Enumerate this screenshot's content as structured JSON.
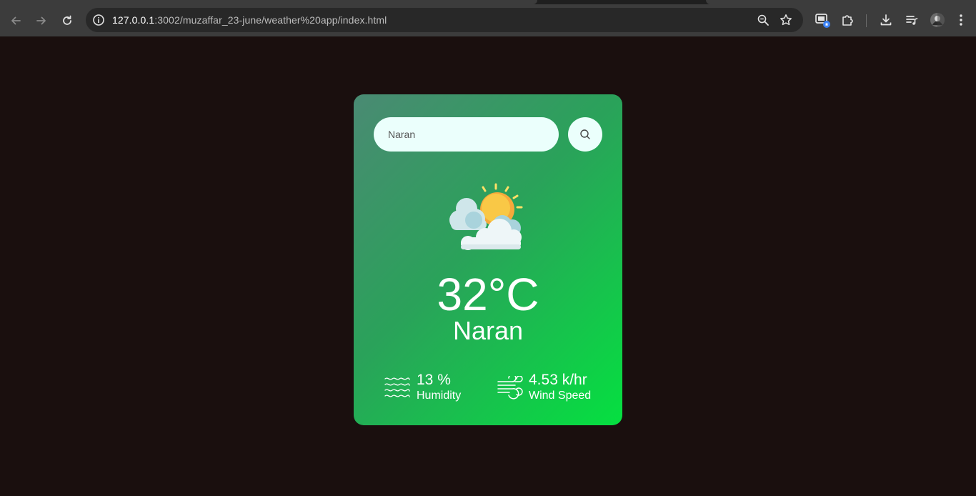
{
  "browser": {
    "url_host": "127.0.0.1",
    "url_path": ":3002/muzaffar_23-june/weather%20app/index.html",
    "icons": {
      "back": "arrow-left-icon",
      "forward": "arrow-right-icon",
      "reload": "reload-icon",
      "site_info": "info-icon",
      "zoom": "zoom-icon",
      "bookmark": "star-icon",
      "extensions": "puzzle-icon",
      "downloads": "download-icon",
      "media": "media-playlist-icon",
      "menu": "more-vert-icon"
    }
  },
  "weather": {
    "search_value": "Naran",
    "temperature": "32°C",
    "city": "Naran",
    "humidity_value": "13 %",
    "humidity_label": "Humidity",
    "wind_value": "4.53 k/hr",
    "wind_label": "Wind Speed",
    "condition_icon": "sun-behind-clouds-icon"
  },
  "colors": {
    "page_background": "#1a0f0e",
    "card_gradient_start": "#4a8a73",
    "card_gradient_end": "#05e040",
    "input_background": "#ebfffc"
  }
}
